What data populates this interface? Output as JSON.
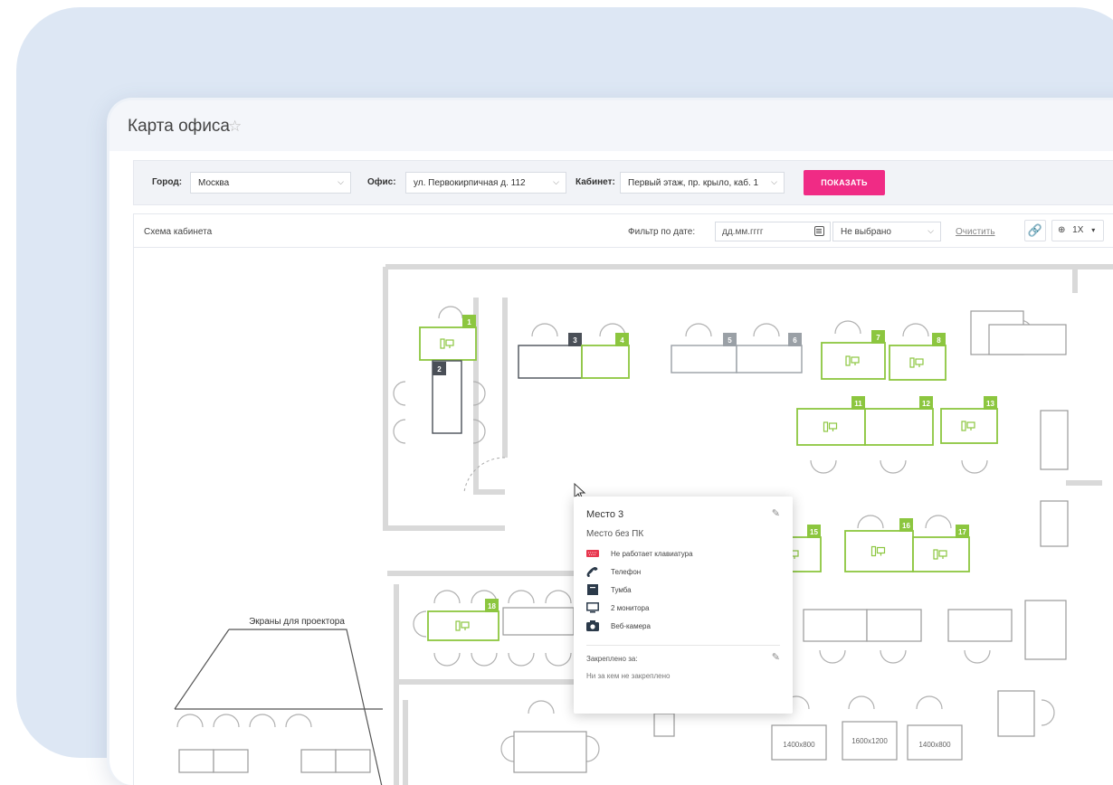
{
  "page": {
    "title": "Карта офиса"
  },
  "filters": {
    "city_label": "Город:",
    "city_value": "Москва",
    "office_label": "Офис:",
    "office_value": "ул. Первокирпичная д. 112",
    "cabinet_label": "Кабинет:",
    "cabinet_value": "Первый этаж, пр. крыло, каб. 1",
    "show_button": "ПОКАЗАТЬ"
  },
  "scheme": {
    "label": "Схема кабинета",
    "date_filter_label": "Фильтр по дате:",
    "date_placeholder": "дд.мм.гггг",
    "status_value": "Не выбрано",
    "clear_link": "Очистить",
    "zoom_value": "1X"
  },
  "map": {
    "projector_label": "Экраны для проектора",
    "table_sizes": [
      "1400x800",
      "1600x1200",
      "1400x800"
    ],
    "desks": [
      {
        "num": "1",
        "state": "available"
      },
      {
        "num": "2",
        "state": "dark"
      },
      {
        "num": "3",
        "state": "dark"
      },
      {
        "num": "4",
        "state": "available"
      },
      {
        "num": "5",
        "state": "grey"
      },
      {
        "num": "6",
        "state": "grey"
      },
      {
        "num": "7",
        "state": "available"
      },
      {
        "num": "8",
        "state": "available"
      },
      {
        "num": "11",
        "state": "available"
      },
      {
        "num": "12",
        "state": "available"
      },
      {
        "num": "13",
        "state": "available"
      },
      {
        "num": "15",
        "state": "available"
      },
      {
        "num": "16",
        "state": "available"
      },
      {
        "num": "17",
        "state": "available"
      },
      {
        "num": "18",
        "state": "available"
      }
    ],
    "colors": {
      "available": "#8cc63f",
      "dark": "#4a4f57",
      "grey": "#9aa0a6",
      "wall": "#d9d9d9",
      "furniture": "#9a9a9a"
    }
  },
  "popup": {
    "title": "Место 3",
    "subtitle": "Место без ПК",
    "features": [
      {
        "icon": "keyboard-icon",
        "label": "Не работает клавиатура"
      },
      {
        "icon": "phone-icon",
        "label": "Телефон"
      },
      {
        "icon": "cabinet-icon",
        "label": "Тумба"
      },
      {
        "icon": "monitor-icon",
        "label": "2 монитора"
      },
      {
        "icon": "camera-icon",
        "label": "Веб-камера"
      }
    ],
    "assigned_label": "Закреплено за:",
    "assigned_value": "Ни за кем не закреплено"
  }
}
